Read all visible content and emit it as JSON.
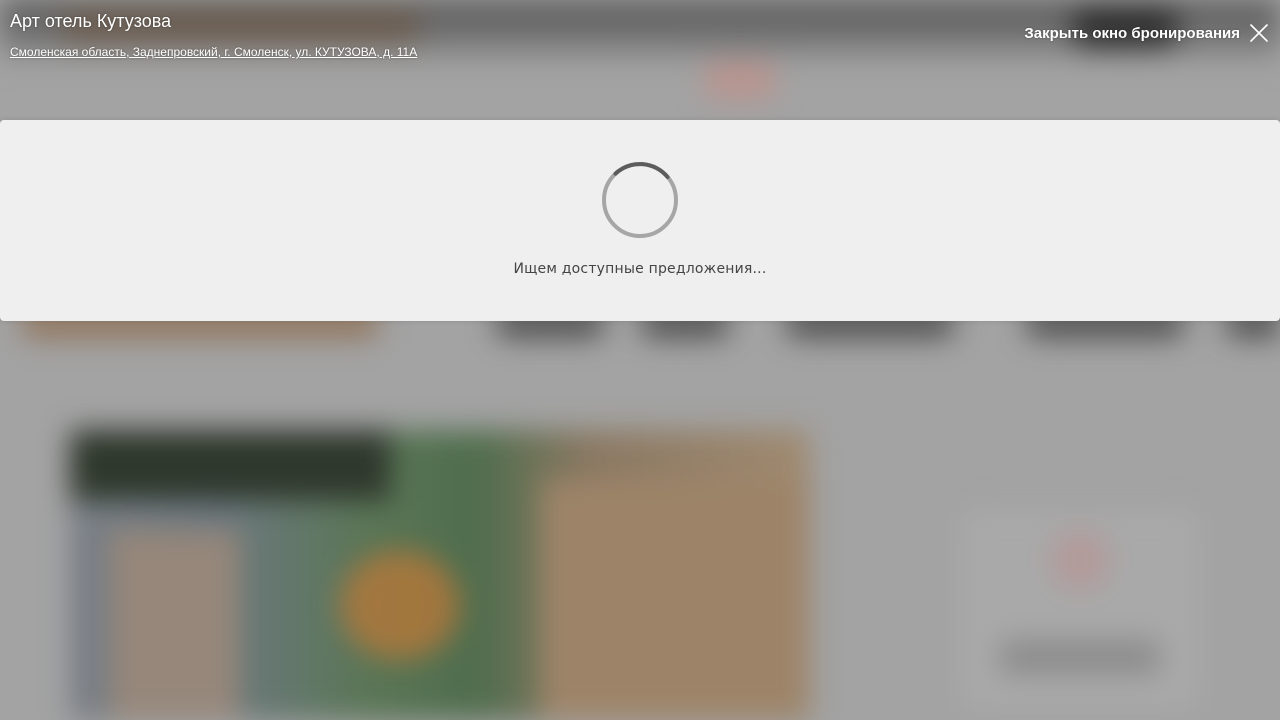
{
  "header": {
    "hotel_name": "Арт отель Кутузова",
    "address": "Смоленская область, Заднепровский, г. Смоленск, ул. КУТУЗОВА, д. 11А",
    "close_label": "Закрыть окно бронирования",
    "close_icon": "close-x-icon"
  },
  "loading": {
    "message": "Ищем доступные предложения...",
    "spinner_icon": "loading-spinner-icon"
  },
  "colors": {
    "overlay_background": "#a3a3a3",
    "panel_background": "#efefef",
    "spinner_track": "#a6a6a6",
    "spinner_arc": "#5c5c5c",
    "header_text": "#ffffff",
    "loading_text": "#444444"
  }
}
